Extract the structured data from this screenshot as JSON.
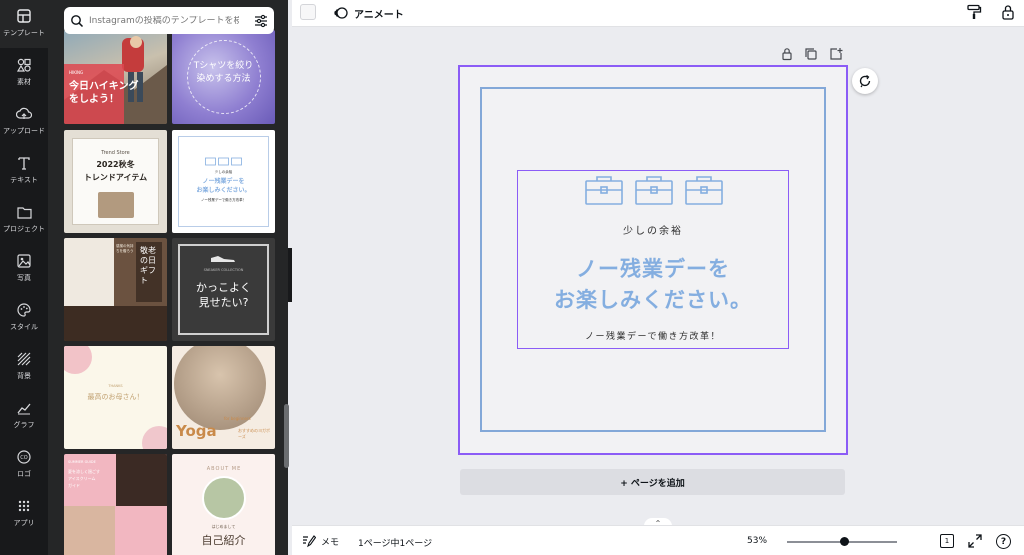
{
  "rail": {
    "items": [
      {
        "label": "テンプレート",
        "icon": "template-icon"
      },
      {
        "label": "素材",
        "icon": "elements-icon"
      },
      {
        "label": "アップロード",
        "icon": "upload-icon"
      },
      {
        "label": "テキスト",
        "icon": "text-icon"
      },
      {
        "label": "プロジェクト",
        "icon": "folder-icon"
      },
      {
        "label": "写真",
        "icon": "photo-icon"
      },
      {
        "label": "スタイル",
        "icon": "palette-icon"
      },
      {
        "label": "背景",
        "icon": "background-icon"
      },
      {
        "label": "グラフ",
        "icon": "chart-icon"
      },
      {
        "label": "ロゴ",
        "icon": "logo-icon"
      },
      {
        "label": "アプリ",
        "icon": "apps-icon"
      }
    ]
  },
  "search": {
    "placeholder": "Instagramの投稿のテンプレートを検索"
  },
  "thumbnails": {
    "t1": {
      "lines": [
        "今日ハイキング",
        "をしよう！"
      ],
      "tag": "HIKING"
    },
    "t2": {
      "lines": [
        "Tシャツを絞り",
        "染めする方法"
      ]
    },
    "t3": {
      "top": "Trend Store",
      "lines": [
        "2022秋冬",
        "トレンドアイテム"
      ]
    },
    "t4": {
      "small": "少しの余裕",
      "lines": [
        "ノー残業デーを",
        "お楽しみください。"
      ],
      "foot": "ノー残業デーで働き方改革！"
    },
    "t5": {
      "lines": [
        "敬老の日",
        "ギフト"
      ],
      "caption": "感謝の気持ちを贈ろう"
    },
    "t6": {
      "lines": [
        "かっこよく",
        "見せたい?"
      ],
      "caption": "SNEAKER COLLECTION"
    },
    "t7": {
      "top": "THANKS",
      "lines": [
        "最高のお母さん！"
      ]
    },
    "t8": {
      "title": "Yoga",
      "sub": "for beginners",
      "note": "おすすめのヨガポーズ"
    },
    "t9": {
      "lines": [
        "夏を涼しく過ごす",
        "アイスクリーム",
        "ガイド"
      ],
      "top": "SUMMER GUIDE"
    },
    "t10": {
      "arc": "ABOUT ME",
      "sub": "はじめまして",
      "title": "自己紹介"
    }
  },
  "toolbar": {
    "animate_label": "アニメート"
  },
  "canvas": {
    "subtitle": "少しの余裕",
    "headline_line1": "ノー残業デーを",
    "headline_line2": "お楽しみください。",
    "footer": "ノー残業デーで働き方改革！",
    "accent_color": "#84aee0",
    "selection_color": "#8b5cf6"
  },
  "add_page_label": "+ ページを追加",
  "bottom": {
    "notes_label": "メモ",
    "page_count": "1ページ中1ページ",
    "zoom": "53%",
    "zoom_fraction": 0.53,
    "pages_badge": "1",
    "help": "?"
  }
}
